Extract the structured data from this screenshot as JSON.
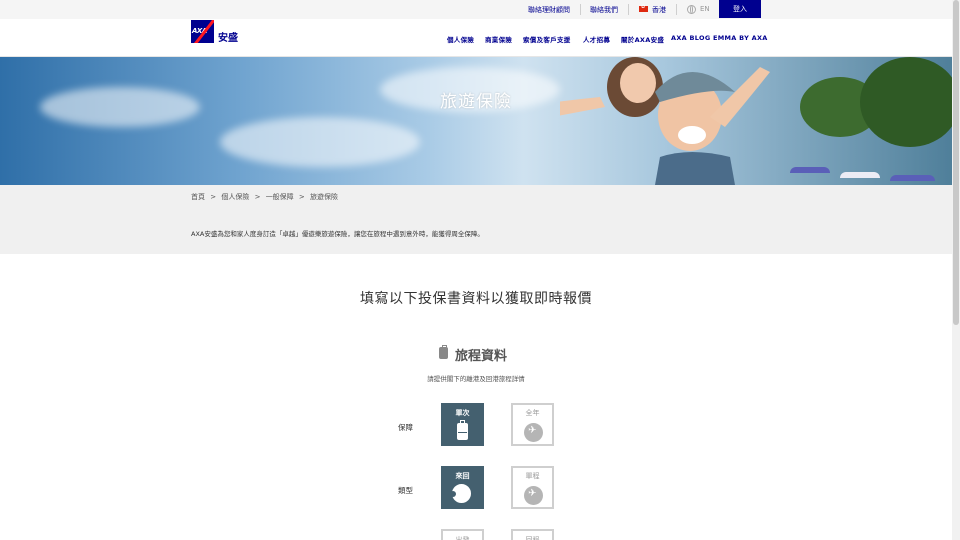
{
  "utility": {
    "advisor": "聯絡理財顧問",
    "contact": "聯絡我們",
    "region": "香港",
    "language": "EN",
    "login": "登入"
  },
  "logo": {
    "text": "AXA",
    "name_cn": "安盛"
  },
  "nav": [
    "個人保險",
    "商業保險",
    "索償及客戶支援",
    "人才招募",
    "關於AXA安盛",
    "AXA BLOG",
    "EMMA BY AXA"
  ],
  "hero": {
    "title": "旅遊保險"
  },
  "breadcrumb": [
    "首頁",
    ">",
    "個人保險",
    ">",
    "一般保障",
    ">",
    "旅遊保險"
  ],
  "intro": "AXA安盛為您和家人度身訂造「卓越」優遊樂旅遊保險，讓您在旅程中遇到意外時，能獲得周全保障。",
  "form": {
    "title": "填寫以下投保書資料以獲取即時報價",
    "section_title": "旅程資料",
    "section_sub": "請提供閣下的離港及回港旅程詳情",
    "rows": [
      {
        "label": "保障",
        "options": [
          {
            "label": "單次",
            "selected": true,
            "icon": "suitcase-icon"
          },
          {
            "label": "全年",
            "selected": false,
            "icon": "plane-icon"
          }
        ]
      },
      {
        "label": "類型",
        "options": [
          {
            "label": "來回",
            "selected": true,
            "icon": "round-trip-icon"
          },
          {
            "label": "單程",
            "selected": false,
            "icon": "one-way-icon"
          }
        ]
      }
    ],
    "next_row_options": [
      "出發",
      "回程"
    ]
  },
  "colors": {
    "brand": "#00008f",
    "accent": "#ff1721",
    "selected": "#44606f"
  }
}
